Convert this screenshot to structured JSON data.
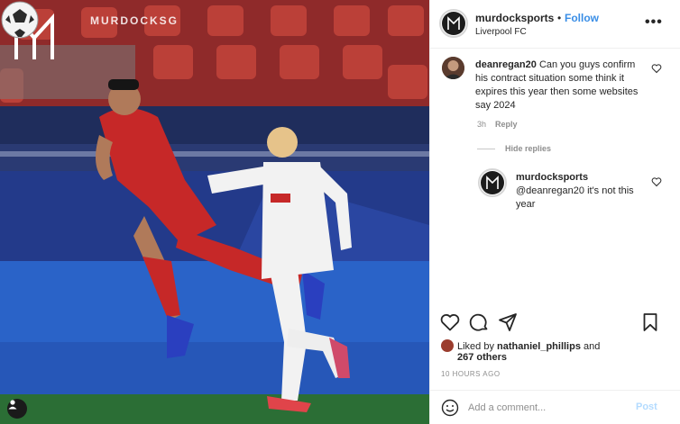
{
  "photo": {
    "watermark_text": "MURDOCKSG",
    "logo_letter": "M",
    "pitch_color": "#2b6e35",
    "sky_color": "#2c3e7a"
  },
  "header": {
    "username": "murdocksports",
    "separator": "•",
    "follow_label": "Follow",
    "location": "Liverpool FC",
    "more_icon": "more-horizontal-icon"
  },
  "comments": [
    {
      "username": "deanregan20",
      "text": "Can you guys confirm his contract situation some think it expires this year then some websites say 2024",
      "time": "3h",
      "reply_label": "Reply",
      "hide_replies_label": "Hide replies"
    }
  ],
  "reply": {
    "username": "murdocksports",
    "text": "@deanregan20 it's not this year"
  },
  "actions": {
    "like_icon": "heart-icon",
    "comment_icon": "comment-icon",
    "share_icon": "paper-plane-icon",
    "save_icon": "bookmark-icon"
  },
  "likes": {
    "prefix": "Liked by",
    "user": "nathaniel_phillips",
    "conj": "and",
    "others": "267 others"
  },
  "posted_time": "10 HOURS AGO",
  "add_comment": {
    "placeholder": "Add a comment...",
    "post_label": "Post"
  },
  "colors": {
    "link_blue": "#3a8ee6",
    "post_disabled": "#b3dbff",
    "muted": "#8e8e8e"
  }
}
